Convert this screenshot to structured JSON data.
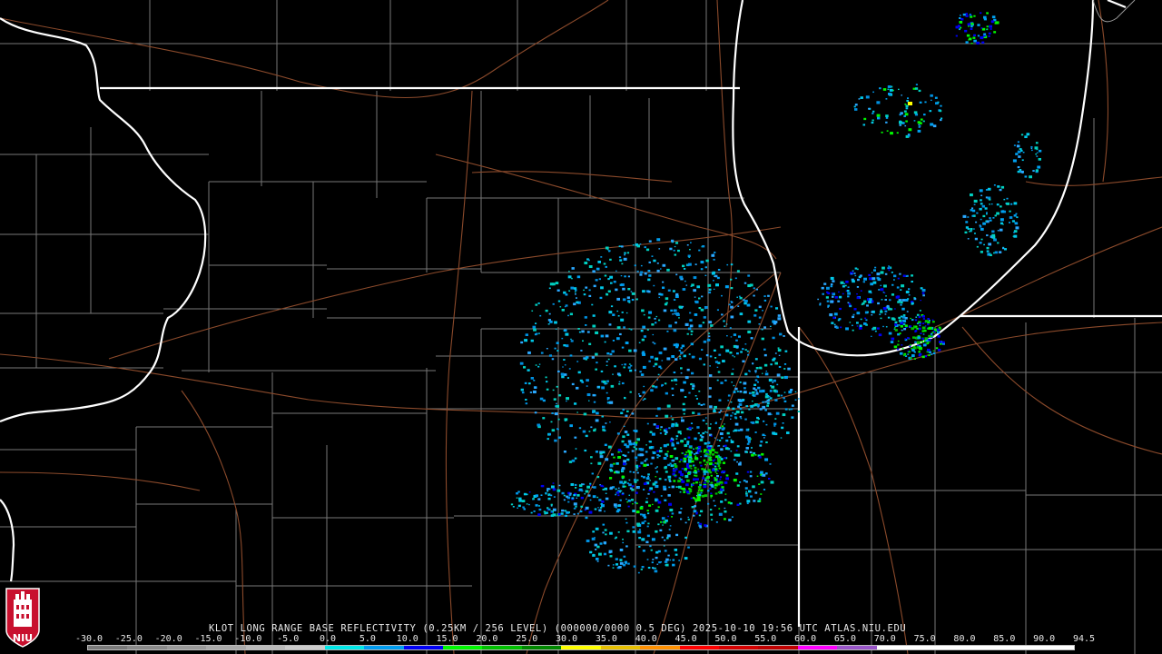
{
  "title": "KLOT LONG RANGE BASE REFLECTIVITY (0.25KM / 256 LEVEL) (000000/0000 0.5 DEG) 2025-10-10 19:56 UTC  ATLAS.NIU.EDU",
  "logo_text": "NIU",
  "scale": {
    "labels": [
      "-30.0",
      "-25.0",
      "-20.0",
      "-15.0",
      "-10.0",
      "-5.0",
      "0.0",
      "5.0",
      "10.0",
      "15.0",
      "20.0",
      "25.0",
      "30.0",
      "35.0",
      "40.0",
      "45.0",
      "50.0",
      "55.0",
      "60.0",
      "65.0",
      "70.0",
      "75.0",
      "80.0",
      "85.0",
      "90.0",
      "94.5"
    ],
    "colors": [
      "#7a7a7a",
      "#8a8a8a",
      "#9a9a9a",
      "#aaaaaa",
      "#bbbbbb",
      "#cccccc",
      "#00e8e8",
      "#009cf0",
      "#0000f4",
      "#00f800",
      "#00c000",
      "#008800",
      "#ffff00",
      "#e7c000",
      "#ff9000",
      "#ff0000",
      "#d60000",
      "#c00000",
      "#ff00ff",
      "#9955c8",
      "#ffffff",
      "#ffffff",
      "#ffffff",
      "#ffffff",
      "#ffffff"
    ]
  },
  "colors": {
    "background": "#000000",
    "state_border": "#ffffff",
    "county_line": "#8c8c8c",
    "road": "#8b4a2b"
  }
}
